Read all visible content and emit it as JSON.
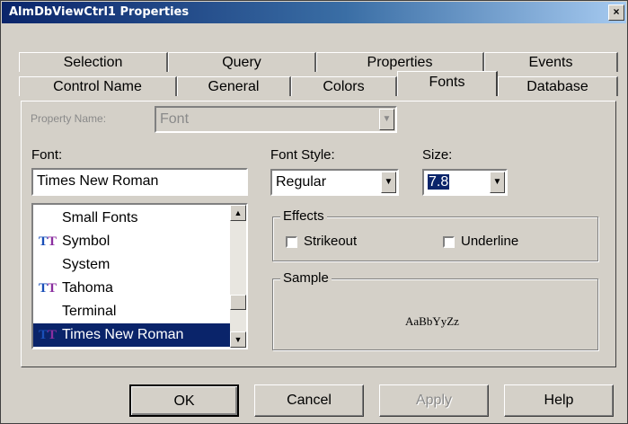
{
  "window": {
    "title": "AlmDbViewCtrl1 Properties",
    "close_glyph": "×"
  },
  "tabs_row1": [
    "Selection",
    "Query",
    "Properties",
    "Events"
  ],
  "tabs_row2": [
    "Control Name",
    "General",
    "Colors",
    "Fonts",
    "Database"
  ],
  "active_tab": "Fonts",
  "property_name": {
    "label": "Property Name:",
    "value": "Font"
  },
  "font": {
    "label": "Font:",
    "value": "Times New Roman"
  },
  "font_list": [
    {
      "name": "Small Fonts",
      "truetype": false,
      "selected": false
    },
    {
      "name": "Symbol",
      "truetype": true,
      "selected": false
    },
    {
      "name": "System",
      "truetype": false,
      "selected": false
    },
    {
      "name": "Tahoma",
      "truetype": true,
      "selected": false
    },
    {
      "name": "Terminal",
      "truetype": false,
      "selected": false
    },
    {
      "name": "Times New Roman",
      "truetype": true,
      "selected": true
    }
  ],
  "font_style": {
    "label": "Font Style:",
    "value": "Regular"
  },
  "size": {
    "label": "Size:",
    "value": "7.8"
  },
  "effects": {
    "label": "Effects",
    "strikeout": "Strikeout",
    "underline": "Underline",
    "strikeout_checked": false,
    "underline_checked": false
  },
  "sample": {
    "label": "Sample",
    "text": "AaBbYyZz"
  },
  "buttons": {
    "ok": "OK",
    "cancel": "Cancel",
    "apply": "Apply",
    "help": "Help"
  },
  "colors": {
    "title_start": "#0a246a",
    "title_end": "#a6caf0",
    "selection": "#0a246a",
    "face": "#d4d0c8"
  }
}
